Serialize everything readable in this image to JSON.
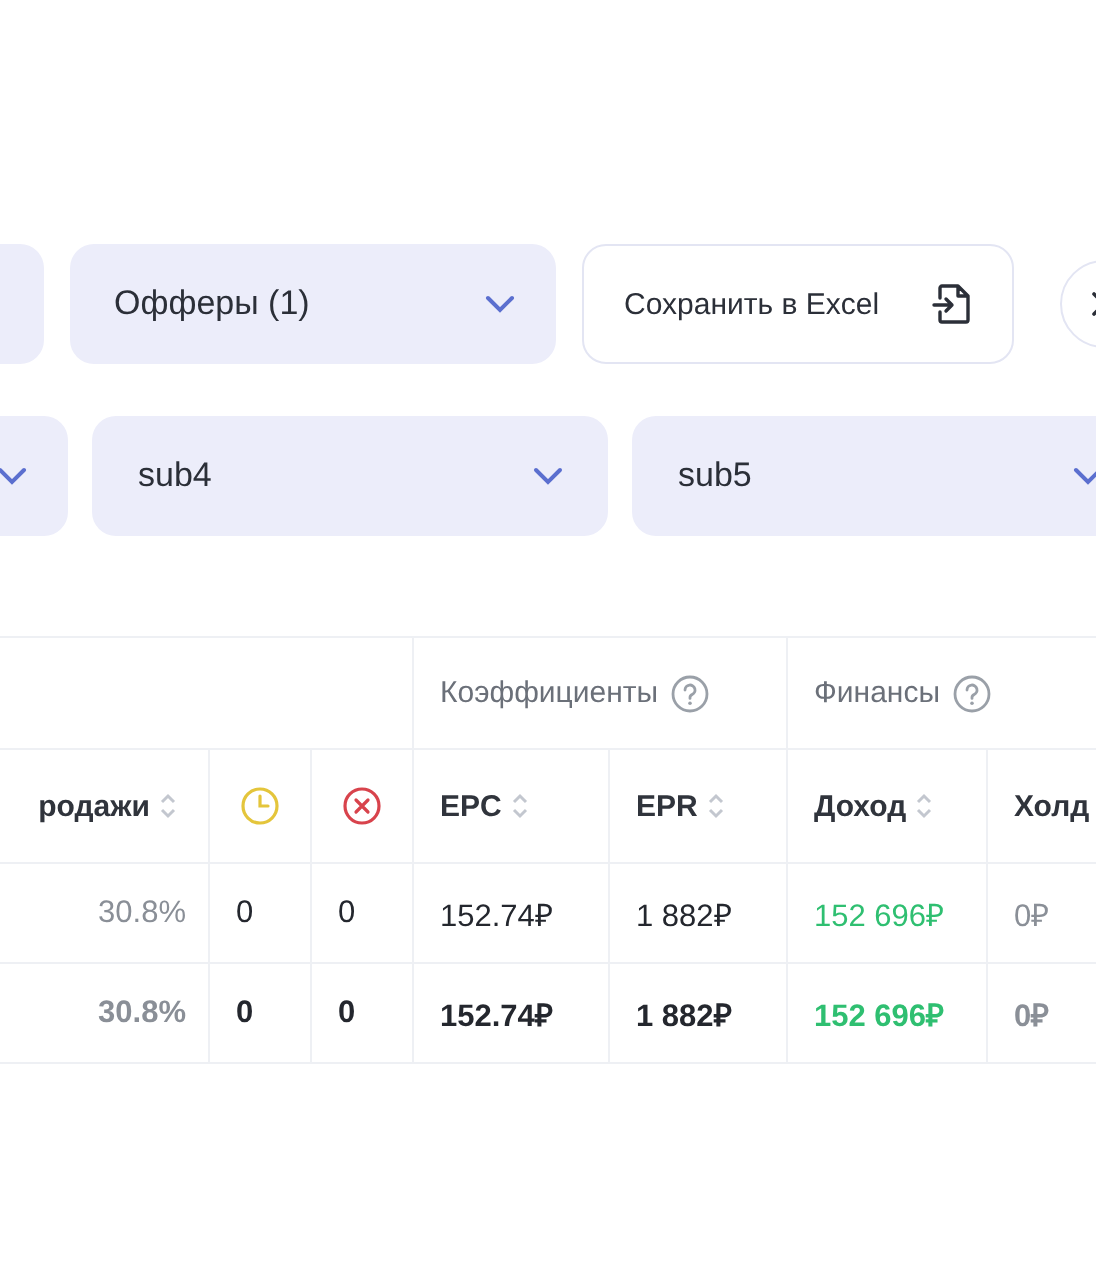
{
  "filters": {
    "offers": {
      "label": "Офферы (1)"
    },
    "export_button": {
      "label": "Сохранить в Excel"
    },
    "sub_fields": [
      {
        "label": "sub4"
      },
      {
        "label": "sub5"
      }
    ]
  },
  "table": {
    "groups": [
      {
        "label": "Коэффициенты",
        "help": true
      },
      {
        "label": "Финансы",
        "help": true
      }
    ],
    "columns": [
      {
        "kind": "text",
        "label": "родажи",
        "sortable": true
      },
      {
        "kind": "pending"
      },
      {
        "kind": "rejected"
      },
      {
        "kind": "text",
        "label": "EPC",
        "sortable": true
      },
      {
        "kind": "text",
        "label": "EPR",
        "sortable": true
      },
      {
        "kind": "text",
        "label": "Доход",
        "sortable": true
      },
      {
        "kind": "text",
        "label": "Холд",
        "sortable": false
      }
    ],
    "rows": [
      {
        "total": false,
        "cells": [
          "30.8%",
          "0",
          "0",
          "152.74₽",
          "1 882₽",
          "152 696₽",
          "0₽"
        ]
      },
      {
        "total": true,
        "cells": [
          "30.8%",
          "0",
          "0",
          "152.74₽",
          "1 882₽",
          "152 696₽",
          "0₽"
        ]
      }
    ]
  }
}
